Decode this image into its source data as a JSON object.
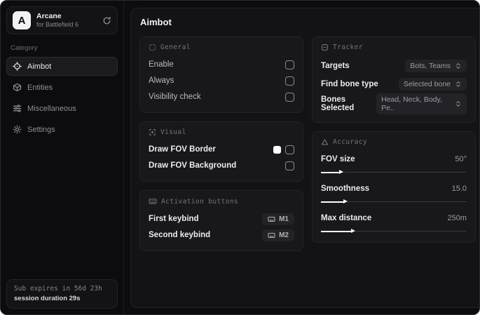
{
  "sidebar": {
    "app": {
      "initial": "A",
      "name": "Arcane",
      "subtitle": "for Battlefield 6"
    },
    "category_label": "Category",
    "items": [
      {
        "label": "Aimbot",
        "icon": "crosshair-icon",
        "active": true
      },
      {
        "label": "Entities",
        "icon": "entities-icon",
        "active": false
      },
      {
        "label": "Miscellaneous",
        "icon": "sliders-icon",
        "active": false
      },
      {
        "label": "Settings",
        "icon": "gear-icon",
        "active": false
      }
    ],
    "subscription": {
      "line1": "Sub expires in 56d 23h",
      "line2": "session duration 29s"
    }
  },
  "main": {
    "title": "Aimbot",
    "cards": {
      "general": {
        "header": "General",
        "rows": [
          {
            "label": "Enable",
            "checked": false
          },
          {
            "label": "Always",
            "checked": false
          },
          {
            "label": "Visibility check",
            "checked": false
          }
        ]
      },
      "visual": {
        "header": "Visual",
        "rows": [
          {
            "label": "Draw FOV Border",
            "swatch_color": "#ffffff",
            "checked": false
          },
          {
            "label": "Draw FOV Background",
            "checked": false
          }
        ]
      },
      "activation": {
        "header": "Activation buttons",
        "rows": [
          {
            "label": "First keybind",
            "key": "M1"
          },
          {
            "label": "Second keybind",
            "key": "M2"
          }
        ]
      },
      "tracker": {
        "header": "Tracker",
        "rows": [
          {
            "label": "Targets",
            "value": "Bots, Teams"
          },
          {
            "label": "Find bone type",
            "value": "Selected bone"
          },
          {
            "label": "Bones Selected",
            "value": "Head, Neck, Body, Pe.."
          }
        ]
      },
      "accuracy": {
        "header": "Accuracy",
        "rows": [
          {
            "label": "FOV size",
            "value": "50°",
            "fill": "13%"
          },
          {
            "label": "Smoothness",
            "value": "15.0",
            "fill": "16%"
          },
          {
            "label": "Max distance",
            "value": "250m",
            "fill": "21%"
          }
        ]
      }
    }
  },
  "colors": {
    "window_bg": "#0c0c0e",
    "panel_bg": "#131316",
    "card_bg": "#18181b",
    "border": "#232328",
    "accent_text": "#ececee",
    "muted_text": "#9a9aa2",
    "swatch_white": "#ffffff"
  }
}
